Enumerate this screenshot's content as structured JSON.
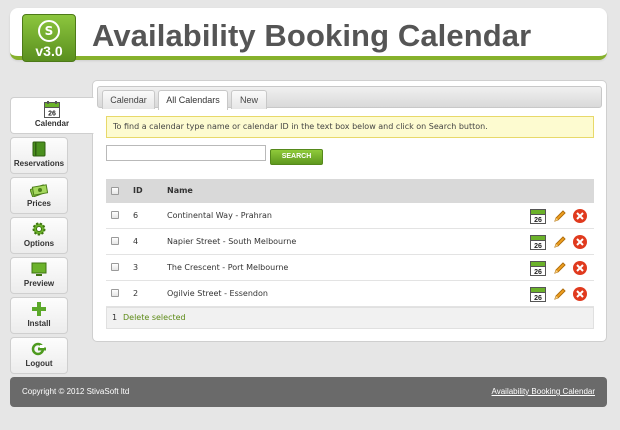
{
  "header": {
    "logo_version": "v3.0",
    "logo_mark": "S",
    "title": "Availability Booking Calendar"
  },
  "sidebar": {
    "items": [
      {
        "label": "Calendar",
        "icon": "calendar-icon",
        "active": true
      },
      {
        "label": "Reservations",
        "icon": "book-icon"
      },
      {
        "label": "Prices",
        "icon": "money-icon"
      },
      {
        "label": "Options",
        "icon": "gear-icon"
      },
      {
        "label": "Preview",
        "icon": "monitor-icon"
      },
      {
        "label": "Install",
        "icon": "plus-icon"
      },
      {
        "label": "Logout",
        "icon": "logout-icon"
      }
    ]
  },
  "tabs": [
    {
      "label": "Calendar"
    },
    {
      "label": "All Calendars",
      "active": true
    },
    {
      "label": "New"
    }
  ],
  "info_text": "To find a calendar type name or calendar ID in the text box below and click on Search button.",
  "search": {
    "value": "",
    "button_label": "SEARCH"
  },
  "table": {
    "headers": {
      "id": "ID",
      "name": "Name"
    },
    "rows": [
      {
        "id": "6",
        "name": "Continental Way - Prahran"
      },
      {
        "id": "4",
        "name": "Napier Street - South Melbourne"
      },
      {
        "id": "3",
        "name": "The Crescent - Port Melbourne"
      },
      {
        "id": "2",
        "name": "Ogilvie Street - Essendon"
      }
    ],
    "calendar_icon_day": "26",
    "footer_count": "1",
    "delete_selected_label": "Delete selected"
  },
  "footer": {
    "copyright": "Copyright © 2012 StivaSoft ltd",
    "link": "Availability Booking Calendar"
  },
  "colors": {
    "accent_green": "#86b12c",
    "delete_red": "#e03a1e",
    "edit_orange": "#f0a020"
  }
}
